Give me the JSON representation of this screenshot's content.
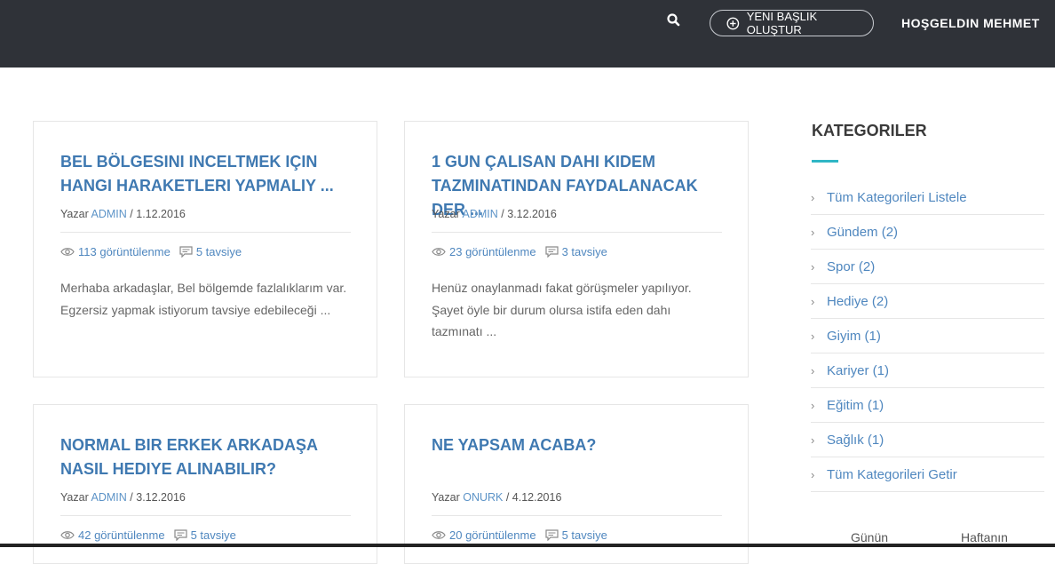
{
  "header": {
    "new_topic_label": "YENI BAŞLIK OLUŞTUR",
    "welcome_text": "HOŞGELDIN MEHMET"
  },
  "posts": [
    {
      "title": "BEL BÖLGESINI INCELTMEK IÇIN HANGI HARAKETLERI YAPMALIY ...",
      "by_label": "Yazar",
      "author": "ADMIN",
      "date": "/ 1.12.2016",
      "views": "113 görüntülenme",
      "recommends": "5 tavsiye",
      "excerpt": "Merhaba arkadaşlar, Bel bölgemde fazlalıklarım var. Egzersiz yapmak istiyorum tavsiye edebileceği ..."
    },
    {
      "title": "1 GUN ÇALISAN DAHI KIDEM TAZMINATINDAN FAYDALANACAK DER ...",
      "by_label": "Yazar",
      "author": "ADMIN",
      "date": "/ 3.12.2016",
      "views": "23 görüntülenme",
      "recommends": "3 tavsiye",
      "excerpt": "Henüz onaylanmadı fakat görüşmeler yapılıyor. Şayet öyle bir durum olursa istifa eden dahı tazmınatı ..."
    },
    {
      "title": "NORMAL BIR ERKEK ARKADAŞA NASIL HEDIYE ALINABILIR?",
      "by_label": "Yazar",
      "author": "ADMIN",
      "date": "/ 3.12.2016",
      "views": "42 görüntülenme",
      "recommends": "5 tavsiye"
    },
    {
      "title": "NE YAPSAM ACABA?",
      "by_label": "Yazar",
      "author": "ONURK",
      "date": "/ 4.12.2016",
      "views": "20 görüntülenme",
      "recommends": "5 tavsiye"
    }
  ],
  "sidebar": {
    "title": "KATEGORILER",
    "items": [
      {
        "label": "Tüm Kategorileri Listele"
      },
      {
        "label": "Gündem (2)"
      },
      {
        "label": "Spor (2)"
      },
      {
        "label": "Hediye (2)"
      },
      {
        "label": "Giyim (1)"
      },
      {
        "label": "Kariyer (1)"
      },
      {
        "label": "Eğitim (1)"
      },
      {
        "label": "Sağlık (1)"
      },
      {
        "label": "Tüm Kategorileri Getir"
      }
    ],
    "tabs": [
      {
        "label": "Günün"
      },
      {
        "label": "Haftanın"
      }
    ]
  },
  "colors": {
    "header_bg": "#2f3238",
    "title_blue": "#3f79b1",
    "link_blue": "#4f87bf",
    "accent_teal": "#2fb6c5"
  }
}
